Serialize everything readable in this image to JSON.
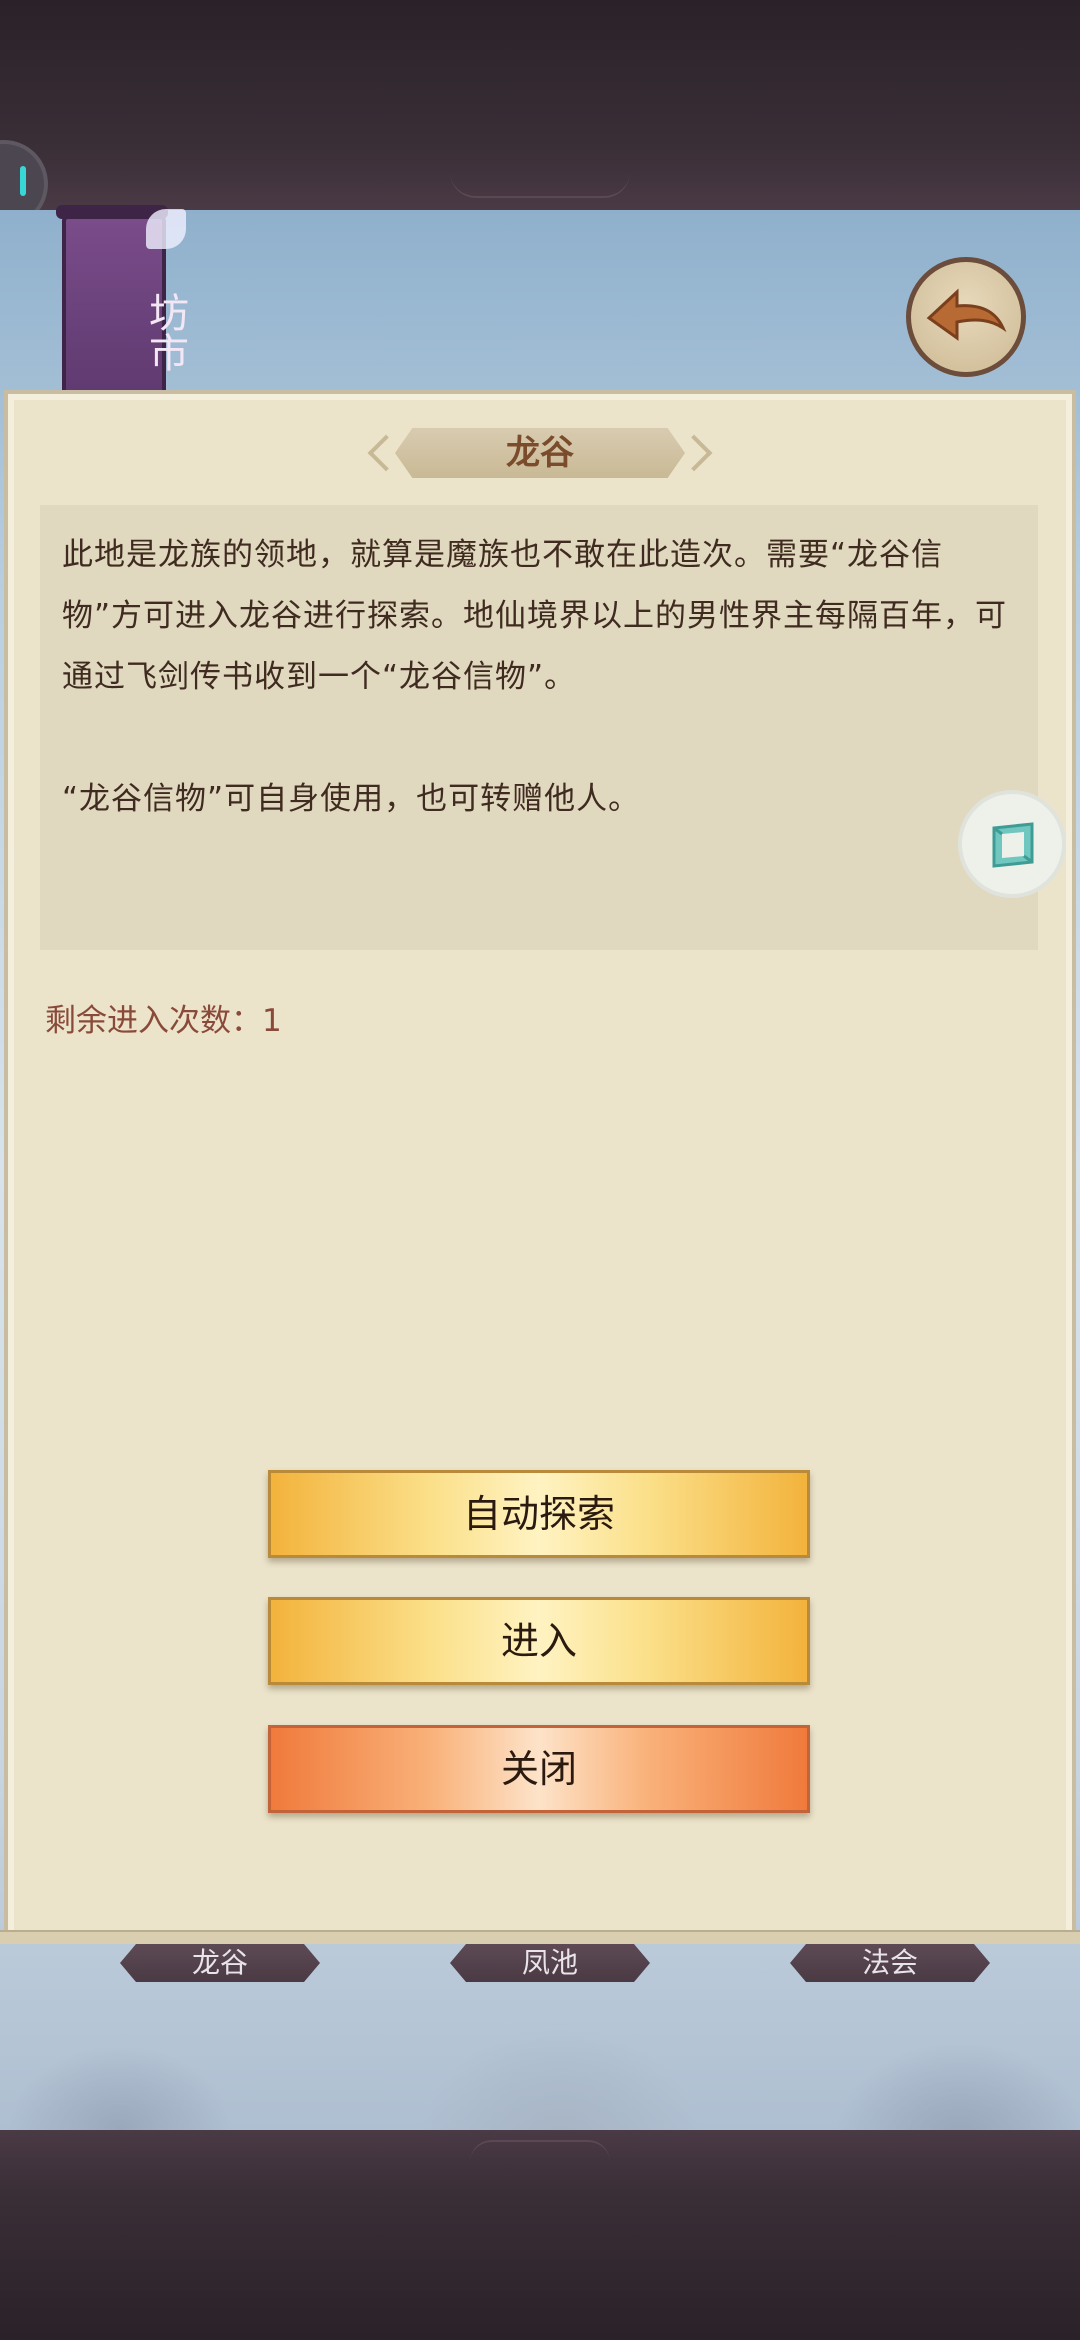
{
  "shop": {
    "label": "坊市"
  },
  "dialog": {
    "title": "龙谷",
    "description_1": "此地是龙族的领地，就算是魔族也不敢在此造次。需要“龙谷信物”方可进入龙谷进行探索。地仙境界以上的男性界主每隔百年，可通过飞剑传书收到一个“龙谷信物”。",
    "description_2": "“龙谷信物”可自身使用，也可转赠他人。",
    "remaining_label": "剩余进入次数：",
    "remaining_count": "1",
    "buttons": {
      "auto_explore": "自动探索",
      "enter": "进入",
      "close": "关闭"
    }
  },
  "map_tabs": [
    "龙谷",
    "凤池",
    "法会"
  ],
  "icons": {
    "back": "back-arrow-icon",
    "side": "cube-icon"
  },
  "colors": {
    "title_text": "#7a4c2c",
    "body_text": "#3f2b1f",
    "remaining_text": "#8a4a3a",
    "button_gold": "#f3b33c",
    "button_orange": "#f07a3c"
  }
}
